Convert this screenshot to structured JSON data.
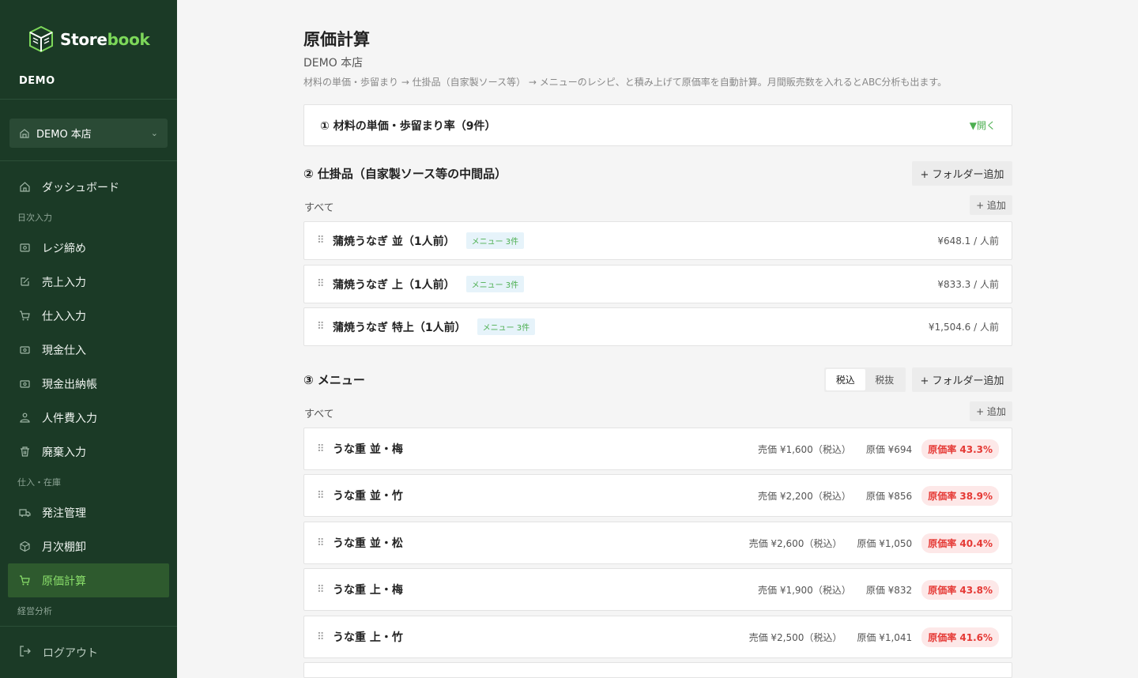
{
  "sidebar": {
    "logo_store": "Store",
    "logo_book": "book",
    "org": "DEMO",
    "store_select": "DEMO 本店",
    "nav": [
      {
        "label": "ダッシュボード",
        "icon": "home-icon"
      },
      {
        "section": "日次入力"
      },
      {
        "label": "レジ締め",
        "icon": "register-icon"
      },
      {
        "label": "売上入力",
        "icon": "edit-icon"
      },
      {
        "label": "仕入入力",
        "icon": "cart-icon"
      },
      {
        "label": "現金仕入",
        "icon": "cash-icon"
      },
      {
        "label": "現金出納帳",
        "icon": "cashbook-icon"
      },
      {
        "label": "人件費入力",
        "icon": "people-icon"
      },
      {
        "label": "廃棄入力",
        "icon": "trash-icon"
      },
      {
        "section": "仕入・在庫"
      },
      {
        "label": "発注管理",
        "icon": "truck-icon"
      },
      {
        "label": "月次棚卸",
        "icon": "box-icon"
      },
      {
        "label": "原価計算",
        "icon": "cart-icon",
        "active": true
      },
      {
        "section": "経営分析"
      }
    ],
    "logout": "ログアウト"
  },
  "page": {
    "title": "原価計算",
    "store": "DEMO 本店",
    "description": "材料の単価・歩留まり → 仕掛品（自家製ソース等） → メニューのレシピ、と積み上げて原価率を自動計算。月間販売数を入れるとABC分析も出ます。"
  },
  "section1": {
    "title": "① 材料の単価・歩留まり率（9件）",
    "toggle": "▼開く"
  },
  "section2": {
    "title": "② 仕掛品（自家製ソース等の中間品）",
    "folder_add": "+ フォルダー追加",
    "all": "すべて",
    "add": "+ 追加",
    "items": [
      {
        "name": "蒲焼うなぎ 並（1人前）",
        "badge": "メニュー 3件",
        "cost": "¥648.1 / 人前"
      },
      {
        "name": "蒲焼うなぎ 上（1人前）",
        "badge": "メニュー 3件",
        "cost": "¥833.3 / 人前"
      },
      {
        "name": "蒲焼うなぎ 特上（1人前）",
        "badge": "メニュー 3件",
        "cost": "¥1,504.6 / 人前"
      }
    ]
  },
  "section3": {
    "title": "③ メニュー",
    "tax_in": "税込",
    "tax_out": "税抜",
    "folder_add": "+ フォルダー追加",
    "all": "すべて",
    "add": "+ 追加",
    "items": [
      {
        "name": "うな重 並・梅",
        "price": "売価 ¥1,600（税込）",
        "cost": "原価 ¥694",
        "ratio": "原価率 43.3%"
      },
      {
        "name": "うな重 並・竹",
        "price": "売価 ¥2,200（税込）",
        "cost": "原価 ¥856",
        "ratio": "原価率 38.9%"
      },
      {
        "name": "うな重 並・松",
        "price": "売価 ¥2,600（税込）",
        "cost": "原価 ¥1,050",
        "ratio": "原価率 40.4%"
      },
      {
        "name": "うな重 上・梅",
        "price": "売価 ¥1,900（税込）",
        "cost": "原価 ¥832",
        "ratio": "原価率 43.8%"
      },
      {
        "name": "うな重 上・竹",
        "price": "売価 ¥2,500（税込）",
        "cost": "原価 ¥1,041",
        "ratio": "原価率 41.6%"
      }
    ]
  },
  "colors": {
    "sidebar_bg": "#1b3a26",
    "accent_green": "#7dd85a",
    "ratio_red": "#e53935"
  }
}
